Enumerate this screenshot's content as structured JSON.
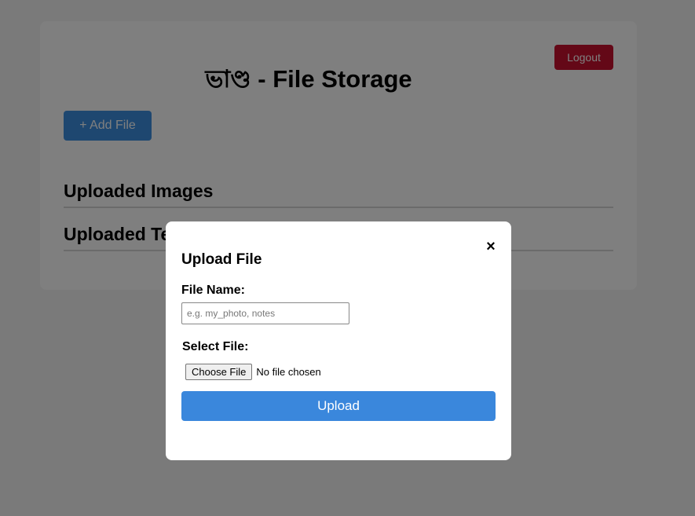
{
  "header": {
    "brand": "ভাণ্ড",
    "title_suffix": " - File Storage",
    "logout_label": "Logout",
    "add_file_label": "+ Add File"
  },
  "sections": {
    "images_title": "Uploaded Images",
    "texts_title": "Uploaded Texts"
  },
  "modal": {
    "title": "Upload File",
    "close_symbol": "×",
    "file_name_label": "File Name:",
    "file_name_placeholder": "e.g. my_photo, notes",
    "file_name_value": "",
    "select_file_label": "Select File:",
    "choose_file_label": "Choose File",
    "no_file_text": "No file chosen",
    "upload_label": "Upload"
  },
  "colors": {
    "logout": "#c8102e",
    "primary": "#3a87dc",
    "overlay": "rgba(0,0,0,0.5)"
  }
}
